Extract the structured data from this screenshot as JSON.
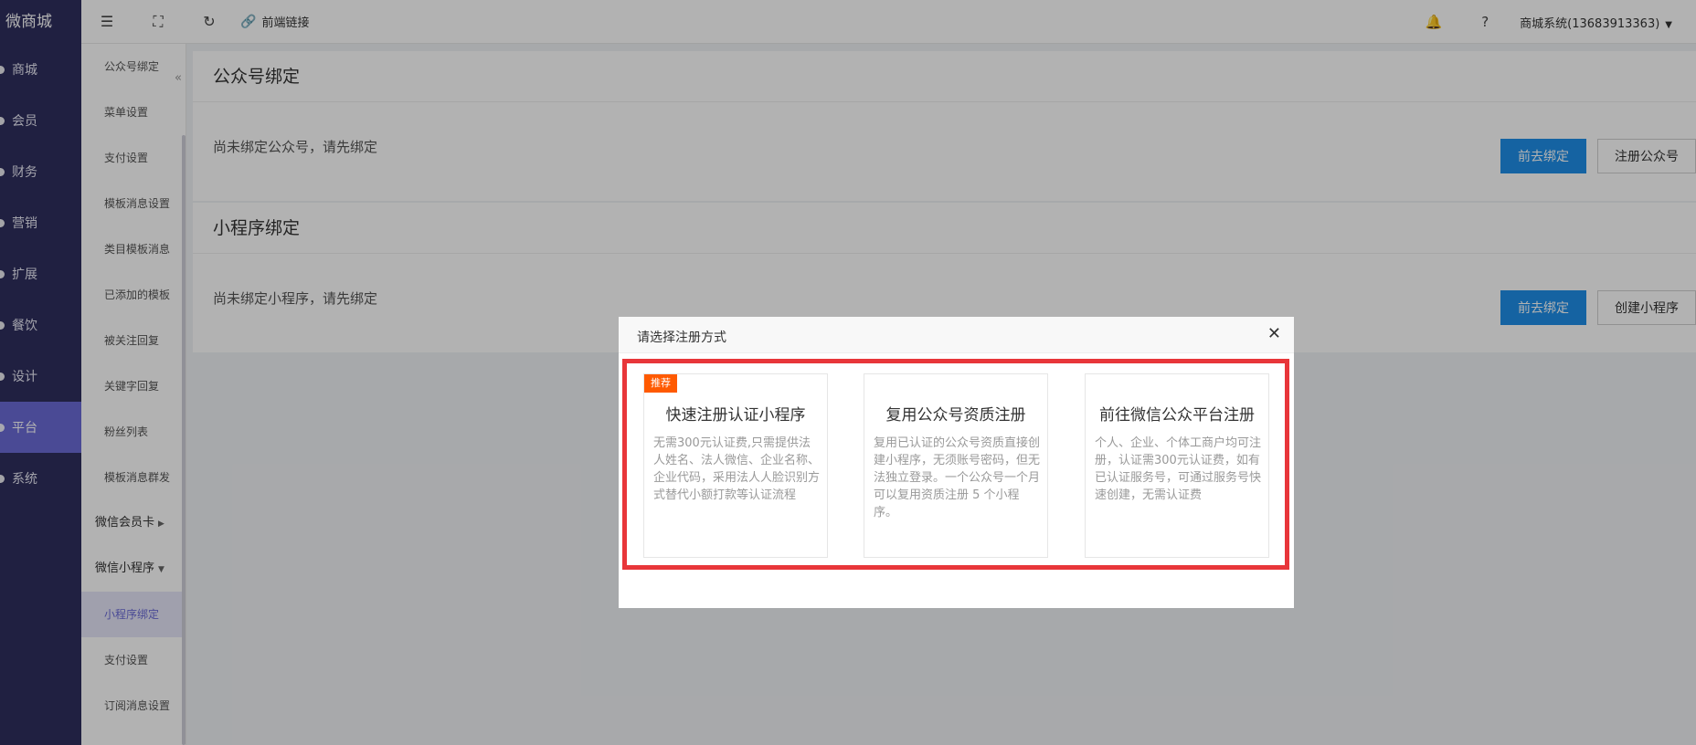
{
  "sidebar": {
    "logo": "微商城",
    "items": [
      {
        "label": "商城",
        "active": false
      },
      {
        "label": "会员",
        "active": false
      },
      {
        "label": "财务",
        "active": false
      },
      {
        "label": "营销",
        "active": false
      },
      {
        "label": "扩展",
        "active": false
      },
      {
        "label": "餐饮",
        "active": false
      },
      {
        "label": "设计",
        "active": false
      },
      {
        "label": "平台",
        "active": true
      },
      {
        "label": "系统",
        "active": false
      }
    ]
  },
  "subnav": {
    "items": [
      "公众号绑定",
      "菜单设置",
      "支付设置",
      "模板消息设置",
      "类目模板消息",
      "已添加的模板",
      "被关注回复",
      "关键字回复",
      "粉丝列表",
      "模板消息群发"
    ],
    "group1": "微信会员卡",
    "group2": "微信小程序",
    "group2_items": [
      "小程序绑定",
      "支付设置",
      "订阅消息设置"
    ]
  },
  "topbar": {
    "link_label": "前端链接",
    "user": "商城系统(13683913363)"
  },
  "cards": [
    {
      "title": "公众号绑定",
      "message": "尚未绑定公众号，请先绑定",
      "primary": "前去绑定",
      "secondary": "注册公众号"
    },
    {
      "title": "小程序绑定",
      "message": "尚未绑定小程序，请先绑定",
      "primary": "前去绑定",
      "secondary": "创建小程序"
    }
  ],
  "dialog": {
    "title": "请选择注册方式",
    "options": [
      {
        "tag": "推荐",
        "title": "快速注册认证小程序",
        "desc": "无需300元认证费,只需提供法人姓名、法人微信、企业名称、企业代码，采用法人人脸识别方式替代小额打款等认证流程"
      },
      {
        "title": "复用公众号资质注册",
        "desc": "复用已认证的公众号资质直接创建小程序，无须账号密码，但无法独立登录。一个公众号一个月可以复用资质注册 5 个小程序。"
      },
      {
        "title": "前往微信公众平台注册",
        "desc": "个人、企业、个体工商户均可注册，认证需300元认证费，如有已认证服务号，可通过服务号快速创建，无需认证费"
      }
    ]
  },
  "colors": {
    "sidebar_bg": "#2f2f5e",
    "active_item": "#6a6ad6",
    "primary_button": "#1f8fe8",
    "highlight_border": "#e8363a",
    "tag_bg": "#ff5a00"
  }
}
